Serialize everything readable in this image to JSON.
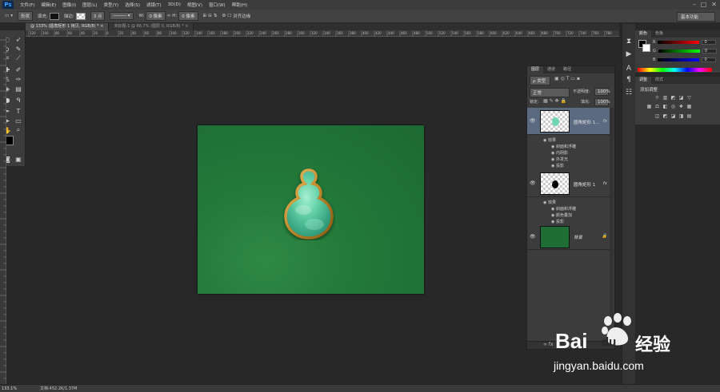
{
  "app": {
    "logo": "Ps"
  },
  "menu": [
    "文件(F)",
    "编辑(E)",
    "图像(I)",
    "图层(L)",
    "类型(Y)",
    "选择(S)",
    "滤镜(T)",
    "3D(D)",
    "视图(V)",
    "窗口(W)",
    "帮助(H)"
  ],
  "window_controls": [
    "–",
    "□",
    "✕"
  ],
  "options": {
    "mode": "形状",
    "fill_label": "填充:",
    "stroke_label": "描边:",
    "stroke_size": "3 点",
    "w_label": "W:",
    "w_value": "0 像素",
    "h_label": "H:",
    "h_value": "0 像素",
    "align_edges": "对齐边缘",
    "workspace": "基本功能"
  },
  "tabs": [
    {
      "label": "@ 133% (圆角矩形 1 拷贝, RGB/8) * ×",
      "active": true
    },
    {
      "label": "未标题-1 @ 66.7% (图层 0, RGB/8) * ×",
      "active": false
    }
  ],
  "ruler_labels": [
    "120",
    "100",
    "80",
    "60",
    "40",
    "20",
    "0",
    "20",
    "40",
    "60",
    "80",
    "100",
    "120",
    "140",
    "160",
    "180",
    "200",
    "220",
    "240",
    "260",
    "280",
    "300",
    "320",
    "340",
    "360",
    "380",
    "400",
    "420",
    "440",
    "460",
    "480",
    "500",
    "520",
    "540",
    "560",
    "580",
    "600",
    "620",
    "640",
    "660",
    "680",
    "700",
    "720",
    "740",
    "760",
    "780"
  ],
  "status": {
    "zoom": "133.1%",
    "doc": "文档:452.2K/1.37M"
  },
  "color_panel": {
    "tabs": [
      "颜色",
      "色板"
    ],
    "r_label": "R",
    "g_label": "G",
    "b_label": "B",
    "r_value": "0",
    "g_value": "0",
    "b_value": "0"
  },
  "adjust_panel": {
    "tabs": [
      "调整",
      "样式"
    ],
    "title": "添加调整"
  },
  "layers_panel": {
    "tabs": [
      "图层",
      "通道",
      "路径"
    ],
    "kind_filter": "ρ 类型",
    "blend_mode": "正常",
    "opacity_label": "不透明度:",
    "opacity_value": "100%",
    "lock_label": "锁定:",
    "fill_label": "填充:",
    "fill_value": "100%",
    "layers": [
      {
        "name": "圆角矩形 1...",
        "fx": "fx",
        "effects_label": "效果",
        "effects": [
          "斜面和浮雕",
          "内阴影",
          "外发光",
          "投影"
        ]
      },
      {
        "name": "圆角矩形 1",
        "fx": "fx",
        "effects_label": "效果",
        "effects": [
          "斜面和浮雕",
          "颜色叠加",
          "投影"
        ]
      },
      {
        "name": "背景",
        "fx": ""
      }
    ]
  },
  "watermark": {
    "brand": "Bai",
    "brand2": "du",
    "jingyan": "经验",
    "url": "jingyan.baidu.com"
  },
  "colors": {
    "canvas_green": "#1f6e36",
    "jade": "#6fd6b0",
    "gold_rim": "#c99433",
    "ui_dark": "#282828"
  }
}
